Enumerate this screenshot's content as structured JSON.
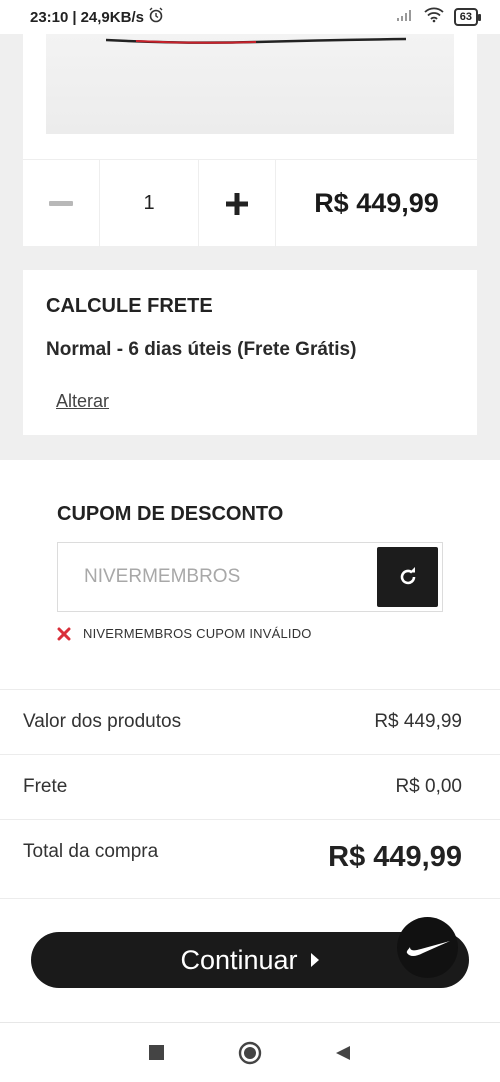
{
  "status_bar": {
    "time": "23:10",
    "speed": "24,9KB/s",
    "battery": "63"
  },
  "product": {
    "quantity": "1",
    "price": "R$ 449,99"
  },
  "shipping": {
    "title": "CALCULE FRETE",
    "option": "Normal - 6 dias úteis (Frete Grátis)",
    "change_label": "Alterar"
  },
  "coupon": {
    "title": "CUPOM DE DESCONTO",
    "placeholder": "NIVERMEMBROS",
    "error": "NIVERMEMBROS CUPOM INVÁLIDO"
  },
  "summary": {
    "products_label": "Valor dos produtos",
    "products_value": "R$ 449,99",
    "shipping_label": "Frete",
    "shipping_value": "R$ 0,00",
    "total_label": "Total da compra",
    "total_value": "R$ 449,99"
  },
  "actions": {
    "continue_label": "Continuar"
  },
  "colors": {
    "accent": "#1a1a1a",
    "error": "#d9303a",
    "background": "#efefef"
  }
}
